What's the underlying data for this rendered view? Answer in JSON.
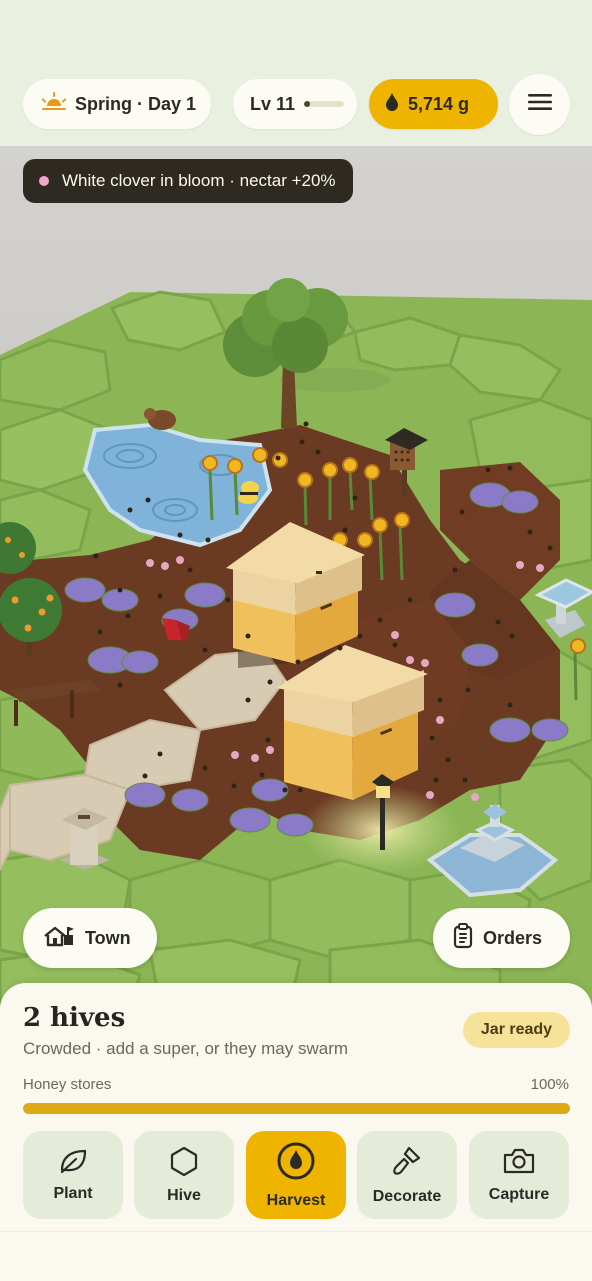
{
  "header": {
    "season_label": "Spring · Day 1",
    "season_icon": "sunrise-icon",
    "level_label": "Lv 11",
    "xp_progress": 0.15,
    "honey_label": "5,714 g",
    "honey_icon": "honey-drop-icon",
    "menu_icon": "hamburger-menu-icon"
  },
  "notification": {
    "text": "White clover in bloom · nectar +20%",
    "dot_color": "#f3a6c8"
  },
  "map_buttons": {
    "town_label": "Town",
    "town_icon": "town-icon",
    "orders_label": "Orders",
    "orders_icon": "clipboard-icon"
  },
  "panel": {
    "title": "2 hives",
    "subtitle": "Crowded · add a super, or they may swarm",
    "badge": "Jar ready",
    "stores_label": "Honey stores",
    "stores_value": "100%",
    "stores_fraction": 1.0
  },
  "actions": [
    {
      "label": "Plant",
      "icon": "leaf-icon",
      "active": false
    },
    {
      "label": "Hive",
      "icon": "hexagon-icon",
      "active": false
    },
    {
      "label": "Harvest",
      "icon": "honey-drop-icon",
      "active": true
    },
    {
      "label": "Decorate",
      "icon": "paintbrush-icon",
      "active": false
    },
    {
      "label": "Capture",
      "icon": "camera-icon",
      "active": false
    }
  ],
  "colors": {
    "accent": "#eeb400",
    "grass": "#8db85a",
    "soil": "#6b3a22",
    "panel_bg": "#fbf8ef"
  }
}
